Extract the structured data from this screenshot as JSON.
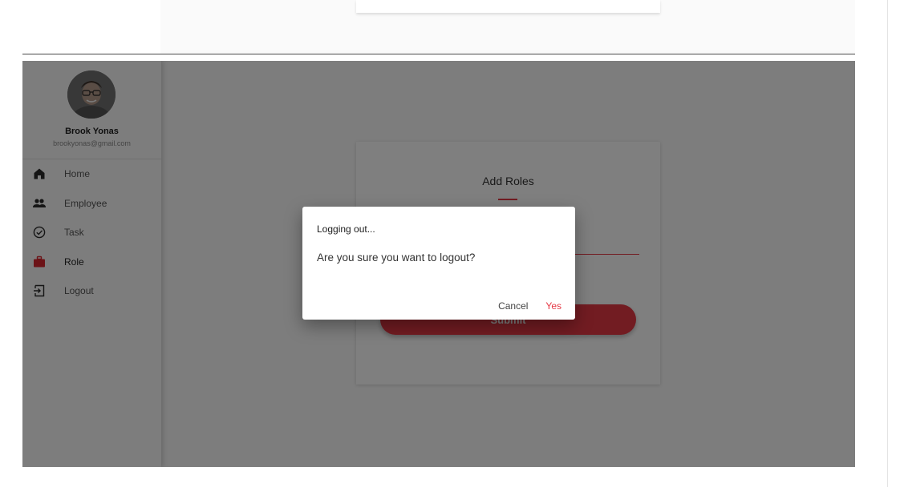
{
  "user": {
    "name": "Brook Yonas",
    "email": "brookyonas@gmail.com"
  },
  "sidebar": {
    "items": [
      {
        "label": "Home",
        "icon": "home-icon"
      },
      {
        "label": "Employee",
        "icon": "people-icon"
      },
      {
        "label": "Task",
        "icon": "check-circle-icon"
      },
      {
        "label": "Role",
        "icon": "briefcase-icon",
        "active": true
      },
      {
        "label": "Logout",
        "icon": "logout-icon"
      }
    ]
  },
  "form": {
    "title": "Add Roles",
    "input_value": "",
    "submit_label": "Submit"
  },
  "dialog": {
    "title": "Logging out...",
    "message": "Are you sure you want to logout?",
    "cancel_label": "Cancel",
    "confirm_label": "Yes"
  },
  "colors": {
    "accent": "#e53945",
    "overlay": "rgba(0,0,0,0.5)"
  }
}
